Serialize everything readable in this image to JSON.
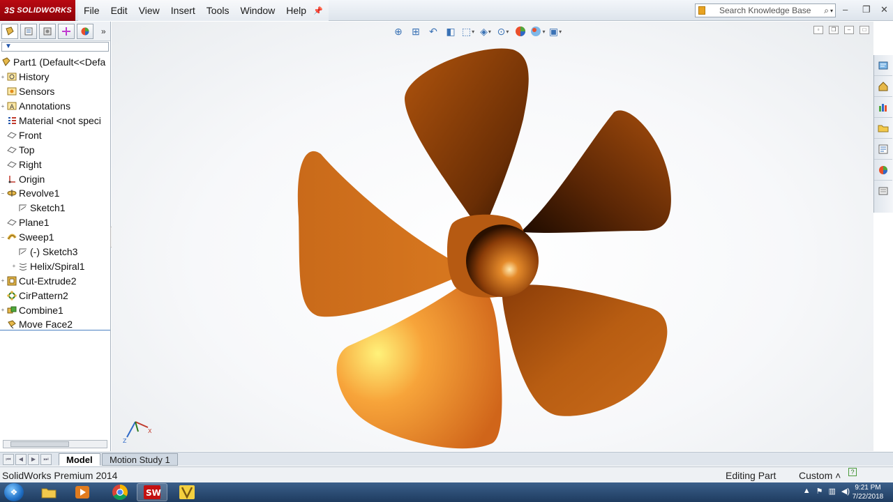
{
  "app": {
    "logo_text": "SOLIDWORKS",
    "logo_prefix": "3S",
    "menu": [
      "File",
      "Edit",
      "View",
      "Insert",
      "Tools",
      "Window",
      "Help"
    ]
  },
  "search": {
    "placeholder": "Search Knowledge Base"
  },
  "feature_tree": {
    "filter_icon": "funnel-icon",
    "nodes": [
      {
        "label": "Part1  (Default<<Defa",
        "icon": "part-icon",
        "expander": ""
      },
      {
        "label": "History",
        "icon": "history-icon",
        "expander": "+"
      },
      {
        "label": "Sensors",
        "icon": "sensors-icon",
        "expander": ""
      },
      {
        "label": "Annotations",
        "icon": "annotations-icon",
        "expander": "+"
      },
      {
        "label": "Material <not speci",
        "icon": "material-icon",
        "expander": ""
      },
      {
        "label": "Front",
        "icon": "plane-icon",
        "expander": ""
      },
      {
        "label": "Top",
        "icon": "plane-icon",
        "expander": ""
      },
      {
        "label": "Right",
        "icon": "plane-icon",
        "expander": ""
      },
      {
        "label": "Origin",
        "icon": "origin-icon",
        "expander": ""
      },
      {
        "label": "Revolve1",
        "icon": "revolve-icon",
        "expander": "−"
      },
      {
        "label": "Sketch1",
        "icon": "sketch-icon",
        "expander": ""
      },
      {
        "label": "Plane1",
        "icon": "plane-icon",
        "expander": ""
      },
      {
        "label": "Sweep1",
        "icon": "sweep-icon",
        "expander": "−"
      },
      {
        "label": "(-) Sketch3",
        "icon": "sketch-icon",
        "expander": ""
      },
      {
        "label": "Helix/Spiral1",
        "icon": "helix-icon",
        "expander": "+"
      },
      {
        "label": "Cut-Extrude2",
        "icon": "cut-extrude-icon",
        "expander": "+"
      },
      {
        "label": "CirPattern2",
        "icon": "circular-pattern-icon",
        "expander": ""
      },
      {
        "label": "Combine1",
        "icon": "combine-icon",
        "expander": "+"
      },
      {
        "label": "Move Face2",
        "icon": "move-face-icon",
        "expander": ""
      }
    ]
  },
  "bottom_tabs": {
    "model": "Model",
    "motion_study": "Motion Study 1"
  },
  "status": {
    "product": "SolidWorks Premium 2014",
    "mode": "Editing Part",
    "units": "Custom ˄",
    "help": "?"
  },
  "clock": {
    "time": "9:21 PM",
    "date": "7/22/2018"
  },
  "colors": {
    "brand": "#a3060e",
    "model_orange": "#d9731a",
    "tree_selection": "#4a7fc1"
  }
}
